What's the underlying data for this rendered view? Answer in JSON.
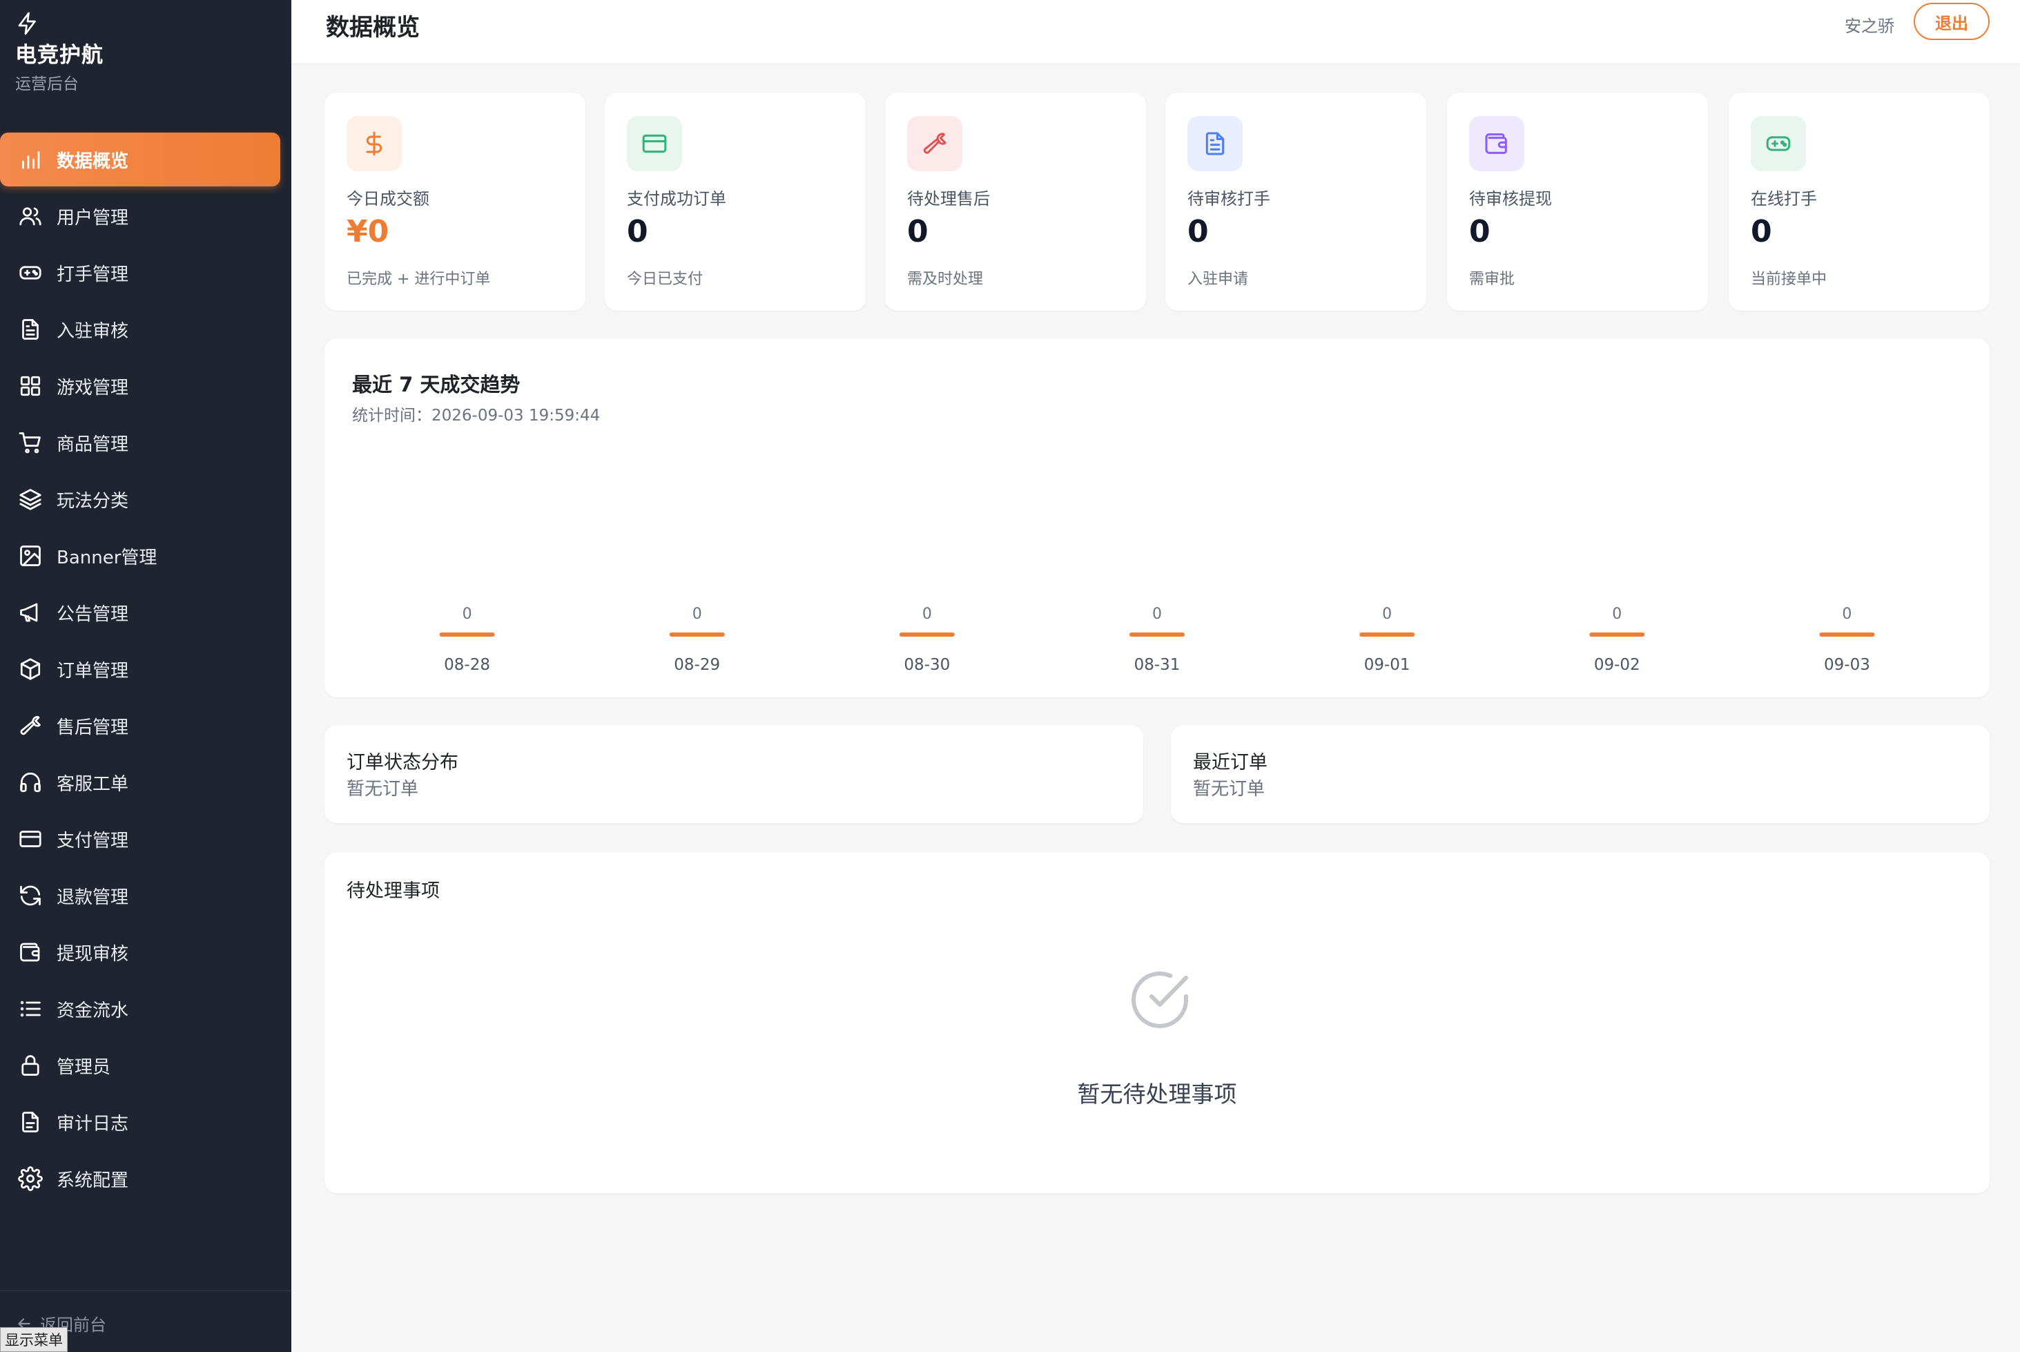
{
  "app": {
    "title": "电竞护航",
    "subtitle": "运营后台"
  },
  "sidebar": {
    "items": [
      {
        "label": "数据概览",
        "icon": "bar-chart-icon",
        "active": true
      },
      {
        "label": "用户管理",
        "icon": "users-icon"
      },
      {
        "label": "打手管理",
        "icon": "gamepad-icon"
      },
      {
        "label": "入驻审核",
        "icon": "document-icon"
      },
      {
        "label": "游戏管理",
        "icon": "grid-icon"
      },
      {
        "label": "商品管理",
        "icon": "cart-icon"
      },
      {
        "label": "玩法分类",
        "icon": "layers-icon"
      },
      {
        "label": "Banner管理",
        "icon": "image-icon"
      },
      {
        "label": "公告管理",
        "icon": "megaphone-icon"
      },
      {
        "label": "订单管理",
        "icon": "box-icon"
      },
      {
        "label": "售后管理",
        "icon": "wrench-icon"
      },
      {
        "label": "客服工单",
        "icon": "headphones-icon"
      },
      {
        "label": "支付管理",
        "icon": "credit-card-icon"
      },
      {
        "label": "退款管理",
        "icon": "refresh-icon"
      },
      {
        "label": "提现审核",
        "icon": "wallet-icon"
      },
      {
        "label": "资金流水",
        "icon": "list-icon"
      },
      {
        "label": "管理员",
        "icon": "lock-icon"
      },
      {
        "label": "审计日志",
        "icon": "file-text-icon"
      },
      {
        "label": "系统配置",
        "icon": "gear-icon"
      }
    ],
    "back_label": "返回前台",
    "show_menu_label": "显示菜单"
  },
  "header": {
    "title": "数据概览",
    "username": "安之骄",
    "logout_label": "退出"
  },
  "stats": [
    {
      "label": "今日成交额",
      "value": "¥0",
      "sub": "已完成 + 进行中订单",
      "icon": "dollar-icon",
      "color": "#ee7d33",
      "bg": "#fdf0e7",
      "accent": true
    },
    {
      "label": "支付成功订单",
      "value": "0",
      "sub": "今日已支付",
      "icon": "credit-card-icon",
      "color": "#2fb37a",
      "bg": "#e8f6ef"
    },
    {
      "label": "待处理售后",
      "value": "0",
      "sub": "需及时处理",
      "icon": "wrench-icon",
      "color": "#e05252",
      "bg": "#fde9e9"
    },
    {
      "label": "待审核打手",
      "value": "0",
      "sub": "入驻申请",
      "icon": "document-icon",
      "color": "#4c7ef0",
      "bg": "#e8eefd"
    },
    {
      "label": "待审核提现",
      "value": "0",
      "sub": "需审批",
      "icon": "wallet-icon",
      "color": "#8b5cf6",
      "bg": "#efe9fd"
    },
    {
      "label": "在线打手",
      "value": "0",
      "sub": "当前接单中",
      "icon": "gamepad-icon",
      "color": "#2fb37a",
      "bg": "#e8f6ef"
    }
  ],
  "trend": {
    "title": "最近 7 天成交趋势",
    "time_label": "统计时间：2026-09-03 19:59:44"
  },
  "chart_data": {
    "type": "bar",
    "categories": [
      "08-28",
      "08-29",
      "08-30",
      "08-31",
      "09-01",
      "09-02",
      "09-03"
    ],
    "values": [
      0,
      0,
      0,
      0,
      0,
      0,
      0
    ],
    "title": "最近 7 天成交趋势",
    "xlabel": "",
    "ylabel": "",
    "grid": false,
    "bar_color": "#ee7d33"
  },
  "order_status": {
    "title": "订单状态分布",
    "empty": "暂无订单"
  },
  "recent_orders": {
    "title": "最近订单",
    "empty": "暂无订单"
  },
  "pending": {
    "title": "待处理事项",
    "empty": "暂无待处理事项",
    "icon": "check-circle-icon"
  }
}
